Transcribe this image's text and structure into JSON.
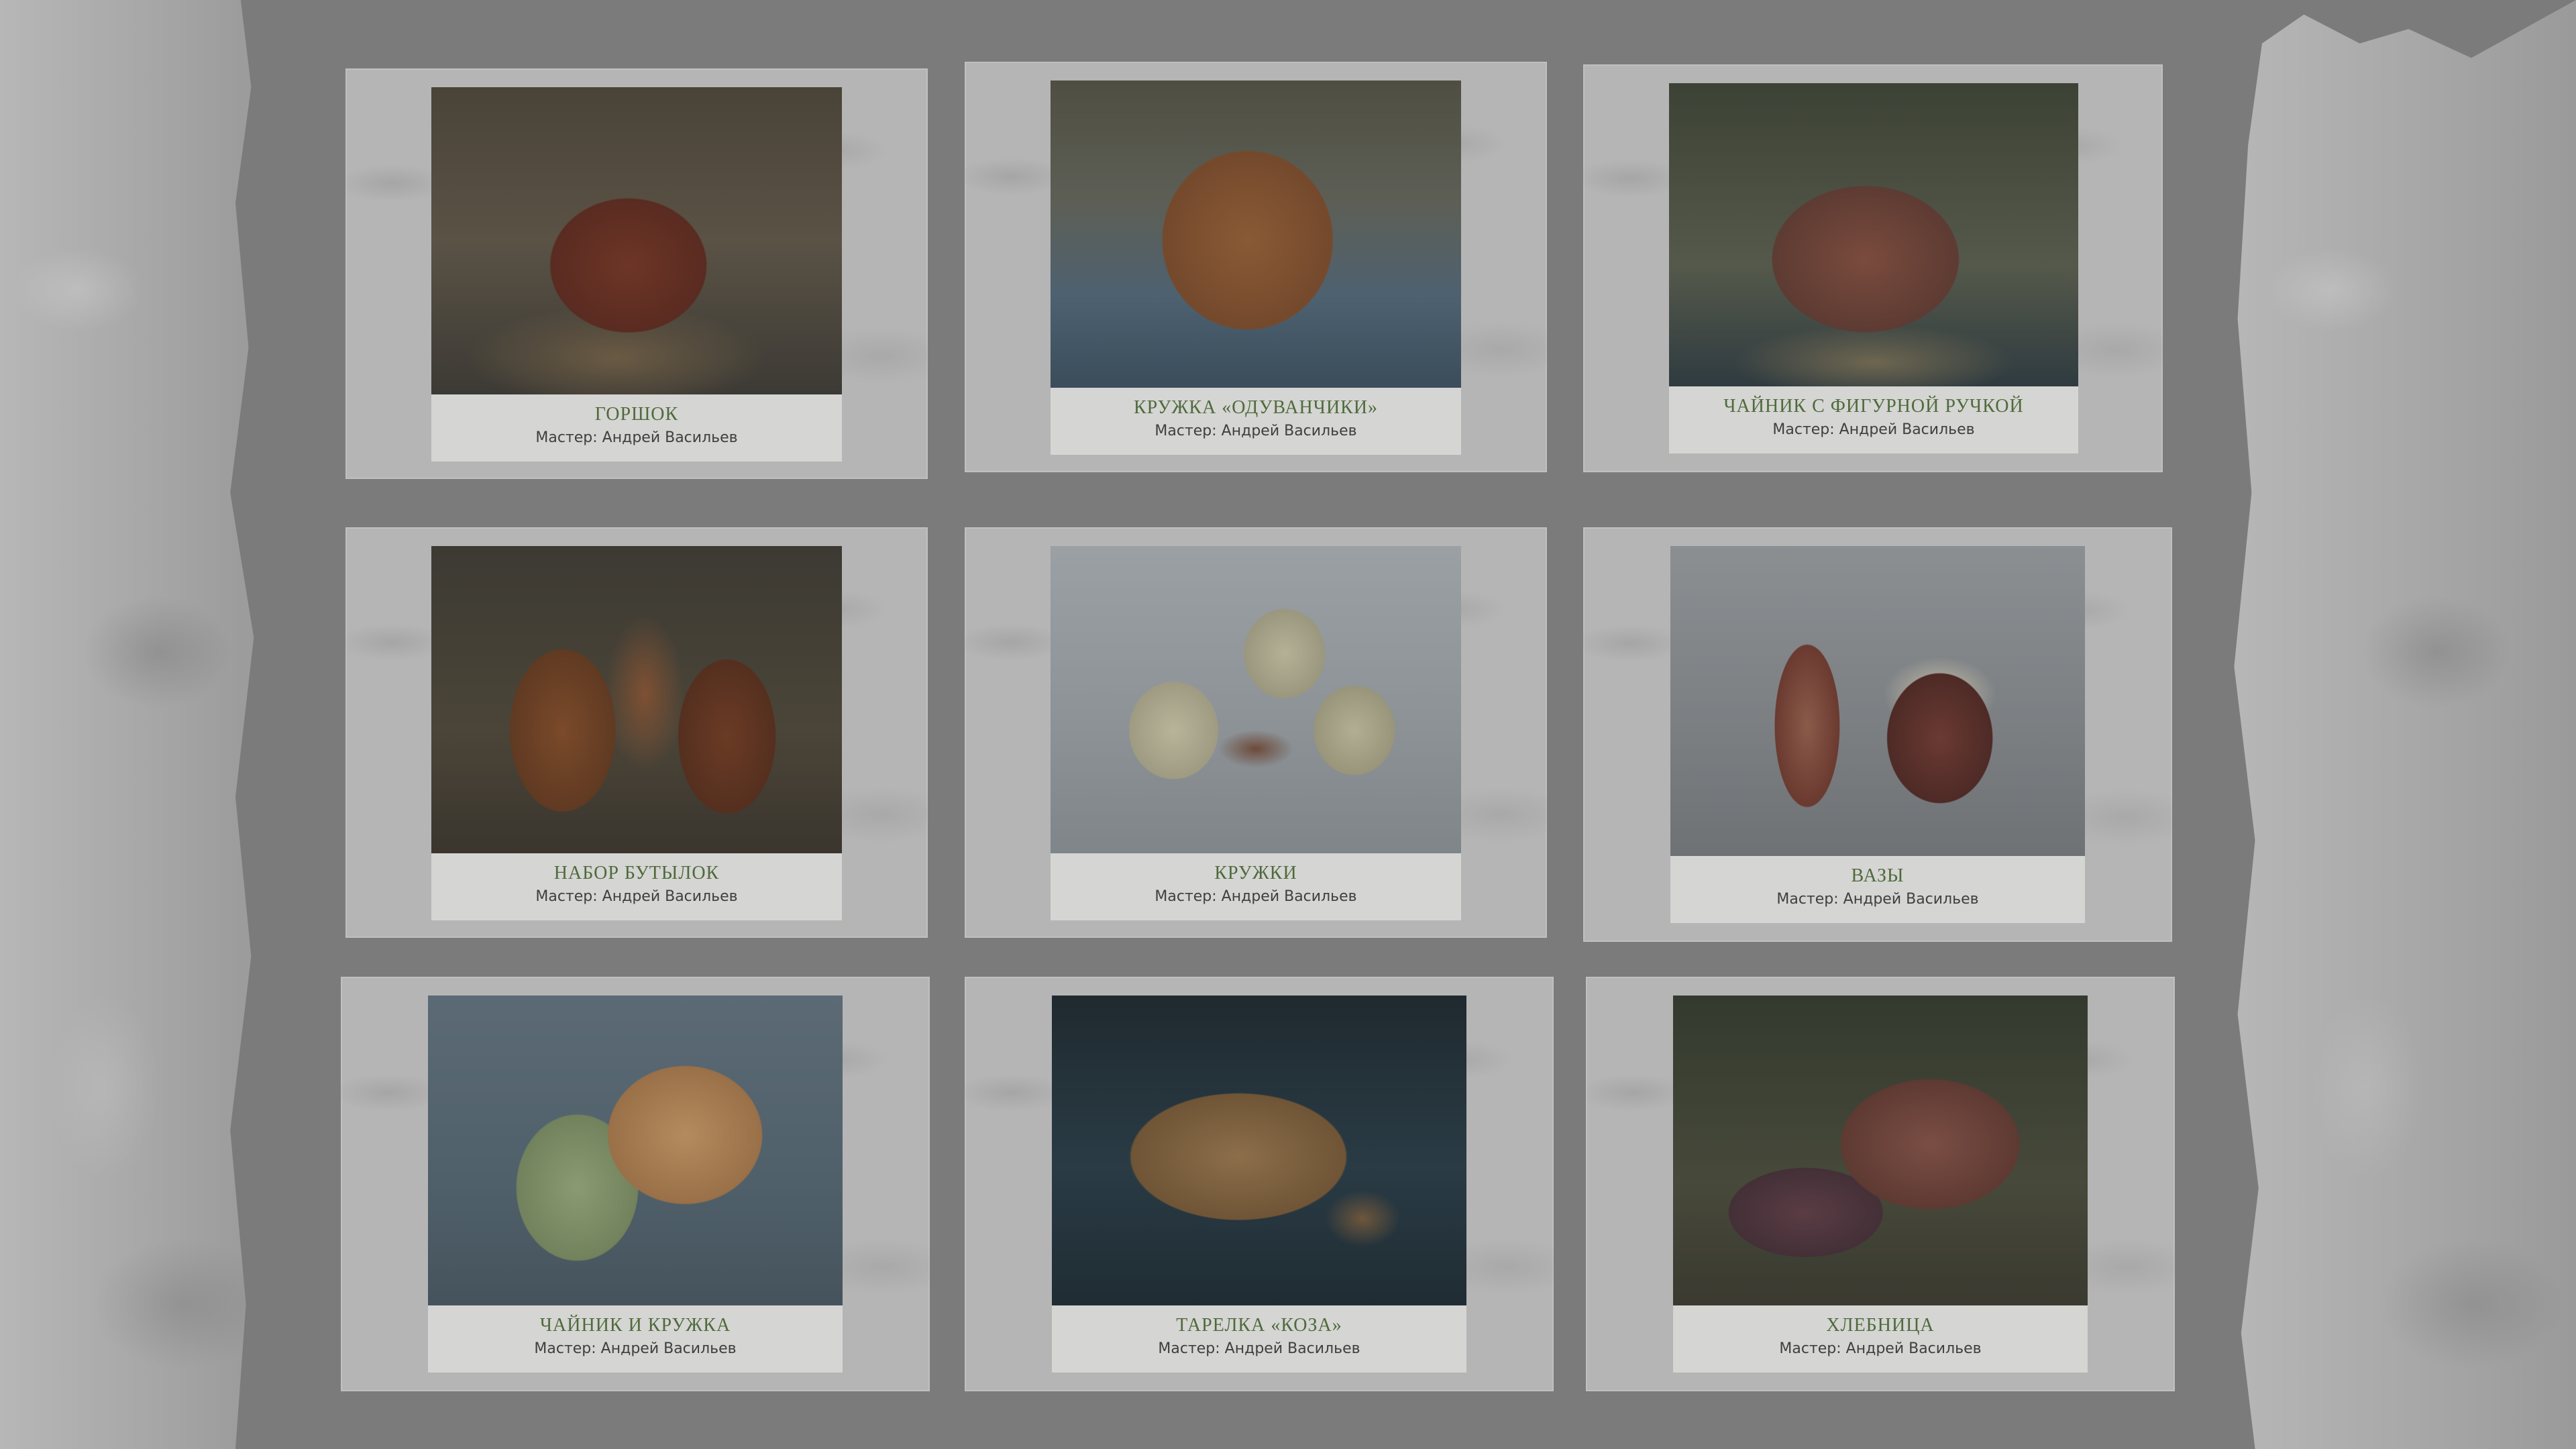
{
  "colors": {
    "background": "#7b7b7b",
    "card": "#b5b5b5",
    "caption": "#d5d5d3",
    "title": "#4f6a3c",
    "master_text": "#3f3f3f"
  },
  "cards": [
    {
      "title": "ГОРШОК",
      "master": "Мастер: Андрей Васильев"
    },
    {
      "title": "КРУЖКА «ОДУВАНЧИКИ»",
      "master": "Мастер: Андрей Васильев"
    },
    {
      "title": "ЧАЙНИК С ФИГУРНОЙ РУЧКОЙ",
      "master": "Мастер: Андрей Васильев"
    },
    {
      "title": "НАБОР БУТЫЛОК",
      "master": "Мастер: Андрей Васильев"
    },
    {
      "title": "КРУЖКИ",
      "master": "Мастер: Андрей Васильев"
    },
    {
      "title": "ВАЗЫ",
      "master": "Мастер: Андрей Васильев"
    },
    {
      "title": "ЧАЙНИК И КРУЖКА",
      "master": "Мастер: Андрей Васильев"
    },
    {
      "title": "ТАРЕЛКА «КОЗА»",
      "master": "Мастер: Андрей Васильев"
    },
    {
      "title": "ХЛЕБНИЦА",
      "master": "Мастер: Андрей Васильев"
    }
  ]
}
